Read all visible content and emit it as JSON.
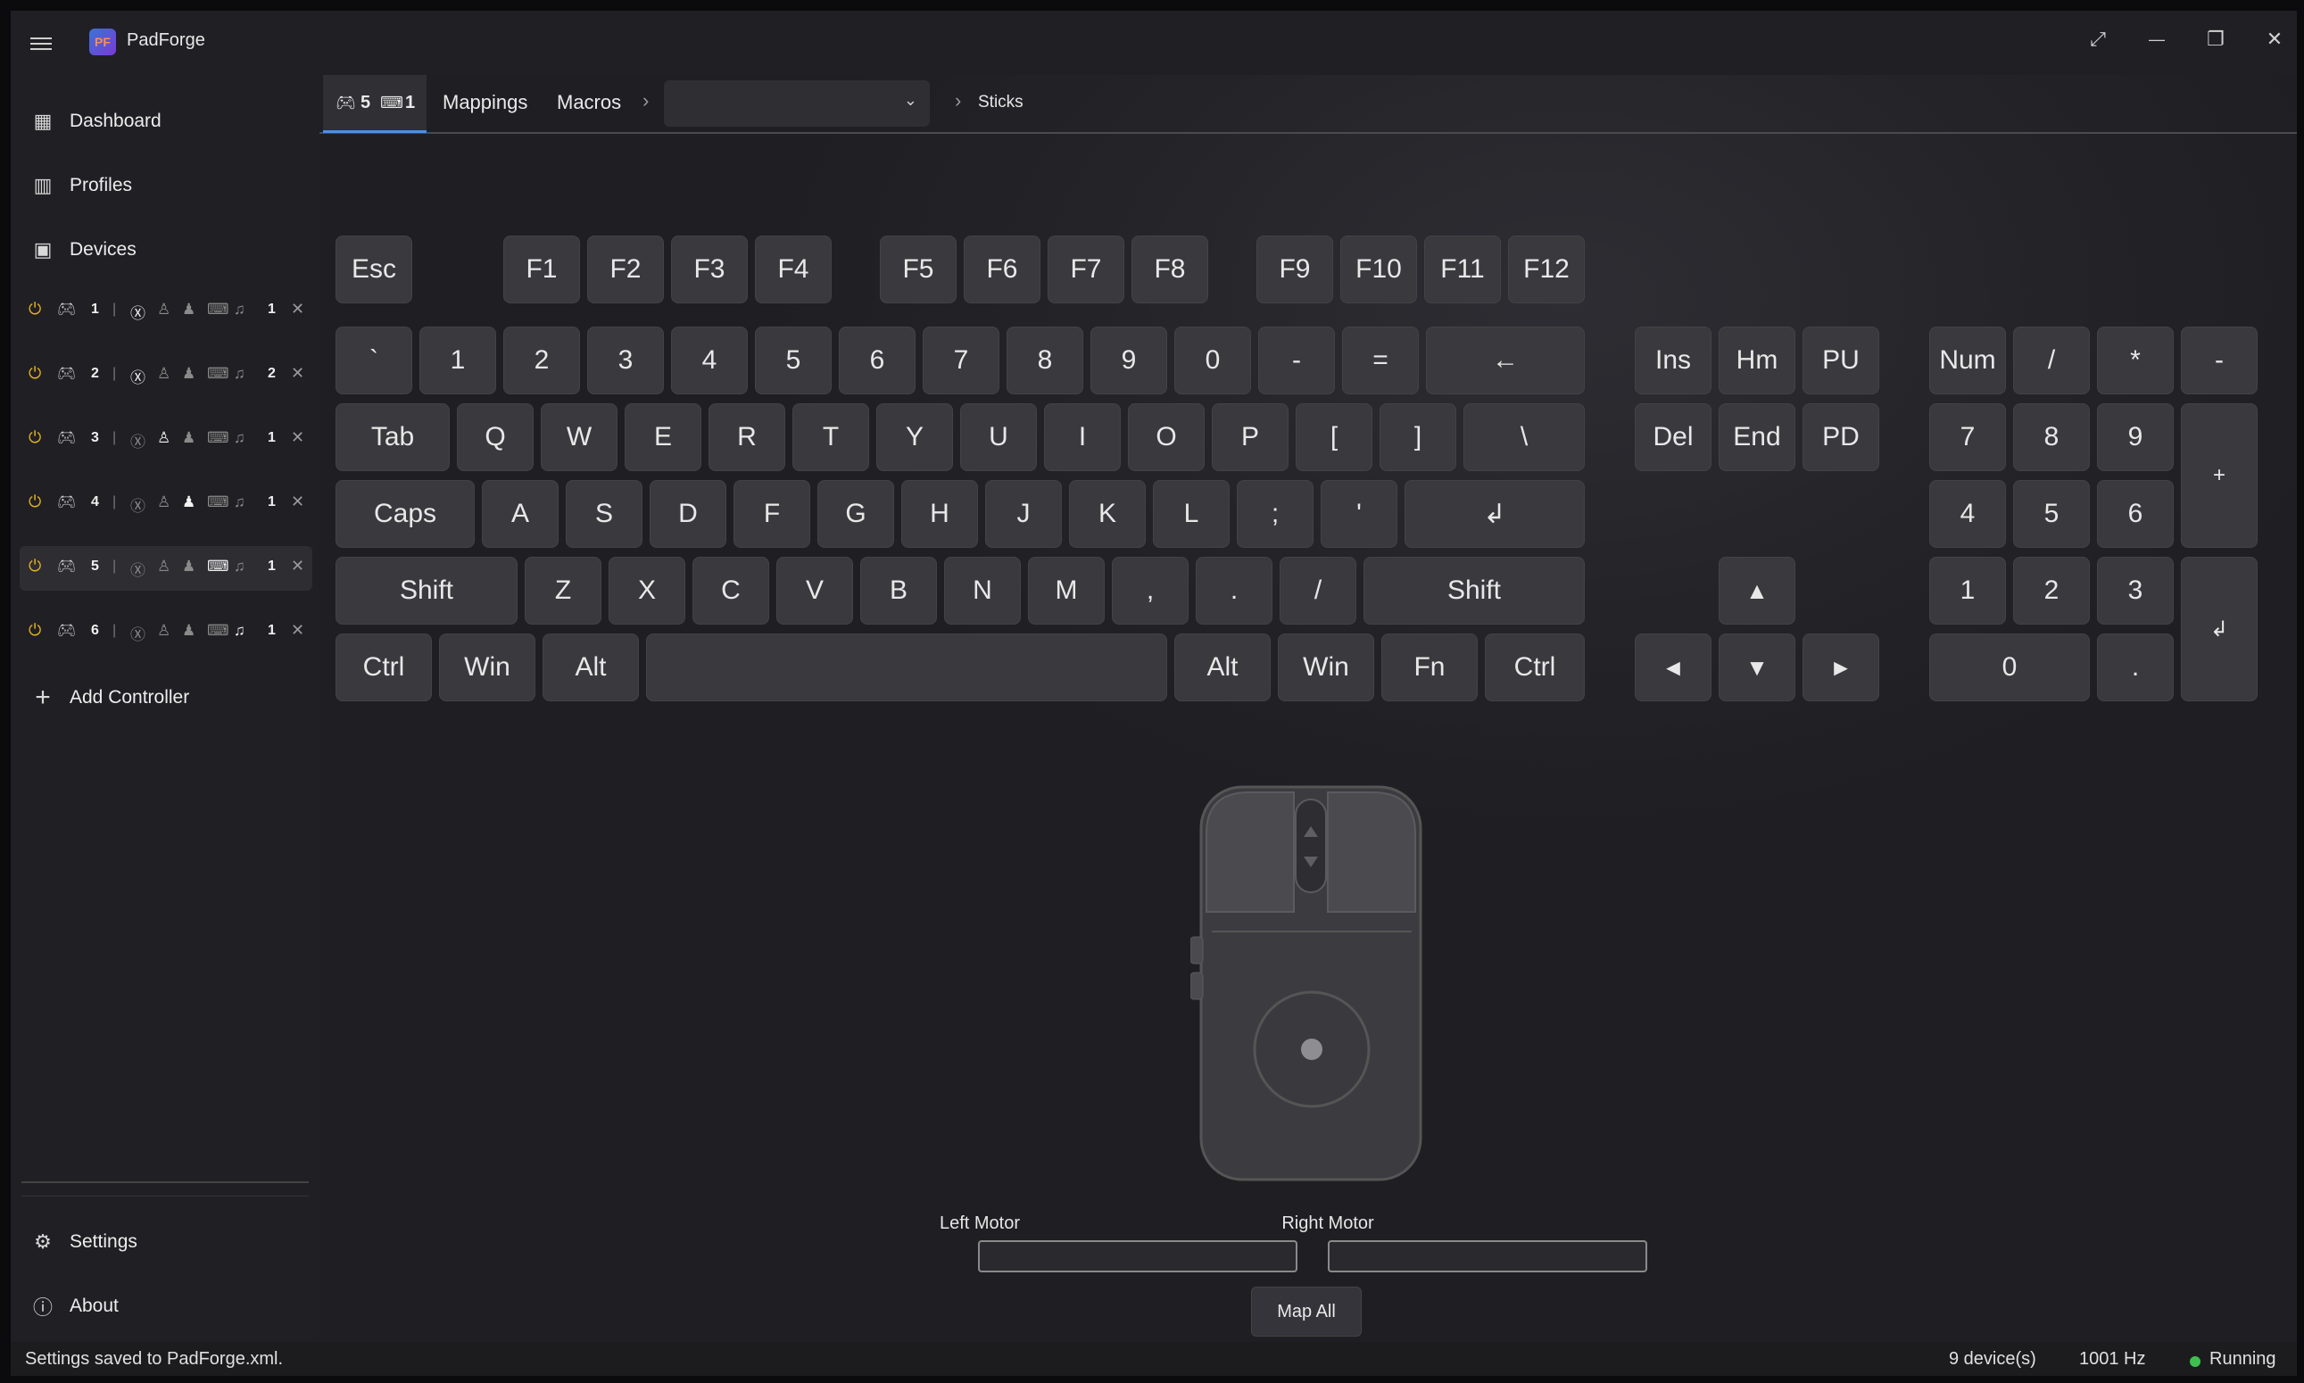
{
  "app": {
    "title": "PadForge",
    "logo_text": "PF"
  },
  "window_controls": {
    "fullscreen": "⤢",
    "minimize": "—",
    "restore": "❐",
    "close": "✕"
  },
  "nav": {
    "dashboard": "Dashboard",
    "profiles": "Profiles",
    "devices": "Devices",
    "add_controller": "Add Controller",
    "settings": "Settings",
    "about": "About"
  },
  "slots": [
    {
      "num": "1",
      "count": "1",
      "type": "xbox"
    },
    {
      "num": "2",
      "count": "2",
      "type": "xbox"
    },
    {
      "num": "3",
      "count": "1",
      "type": "playstation"
    },
    {
      "num": "4",
      "count": "1",
      "type": "generic"
    },
    {
      "num": "5",
      "count": "1",
      "type": "keyboard-mouse"
    },
    {
      "num": "6",
      "count": "1",
      "type": "midi"
    }
  ],
  "tabs": {
    "device_tab": {
      "gamepad_count": "5",
      "kbm_count": "1"
    },
    "mappings": "Mappings",
    "macros": "Macros",
    "dropdown_value": "",
    "breadcrumb": "Sticks"
  },
  "keyboard": {
    "fn_row": [
      "Esc",
      "F1",
      "F2",
      "F3",
      "F4",
      "F5",
      "F6",
      "F7",
      "F8",
      "F9",
      "F10",
      "F11",
      "F12"
    ],
    "row1": [
      "`",
      "1",
      "2",
      "3",
      "4",
      "5",
      "6",
      "7",
      "8",
      "9",
      "0",
      "-",
      "=",
      "←"
    ],
    "row2": [
      "Tab",
      "Q",
      "W",
      "E",
      "R",
      "T",
      "Y",
      "U",
      "I",
      "O",
      "P",
      "[",
      "]",
      "\\"
    ],
    "row3": [
      "Caps",
      "A",
      "S",
      "D",
      "F",
      "G",
      "H",
      "J",
      "K",
      "L",
      ";",
      "'",
      "↲"
    ],
    "row4": [
      "Shift",
      "Z",
      "X",
      "C",
      "V",
      "B",
      "N",
      "M",
      ",",
      ".",
      "/",
      "Shift"
    ],
    "row5": [
      "Ctrl",
      "Win",
      "Alt",
      "",
      "Alt",
      "Win",
      "Fn",
      "Ctrl"
    ],
    "nav_cluster": [
      "Ins",
      "Hm",
      "PU",
      "Del",
      "End",
      "PD"
    ],
    "arrows": [
      "▲",
      "◄",
      "▼",
      "►"
    ],
    "numpad": [
      "Num",
      "/",
      "*",
      "-",
      "7",
      "8",
      "9",
      "+",
      "4",
      "5",
      "6",
      "1",
      "2",
      "3",
      "↲",
      "0",
      "."
    ]
  },
  "motors": {
    "left_label": "Left Motor",
    "right_label": "Right Motor",
    "left_value": 0,
    "right_value": 0
  },
  "map_all": "Map All",
  "status": {
    "message": "Settings saved to PadForge.xml.",
    "devices": "9 device(s)",
    "rate": "1001 Hz",
    "state": "Running"
  },
  "colors": {
    "accent": "#4f8ee8",
    "power": "#e6b422",
    "running": "#3fbf4f"
  }
}
